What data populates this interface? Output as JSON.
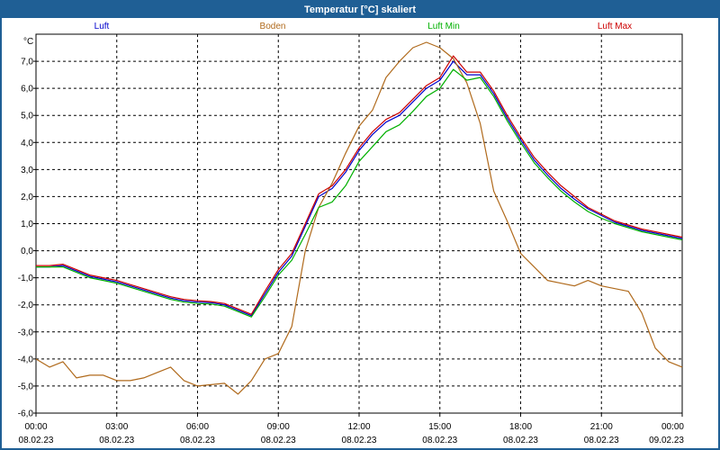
{
  "window": {
    "title": "Temperatur [°C] skaliert"
  },
  "chart_data": {
    "type": "line",
    "title": "Temperatur [°C] skaliert",
    "ylabel": "°C",
    "xlabel": "",
    "xlim": [
      0,
      24
    ],
    "ylim": [
      -6,
      8
    ],
    "grid": true,
    "legend_position": "top",
    "y_ticks": [
      "-6,0",
      "-5,0",
      "-4,0",
      "-3,0",
      "-2,0",
      "-1,0",
      "0,0",
      "1,0",
      "2,0",
      "3,0",
      "4,0",
      "5,0",
      "6,0",
      "7,0"
    ],
    "x_ticks": [
      {
        "time": "00:00",
        "date": "08.02.23"
      },
      {
        "time": "03:00",
        "date": "08.02.23"
      },
      {
        "time": "06:00",
        "date": "08.02.23"
      },
      {
        "time": "09:00",
        "date": "08.02.23"
      },
      {
        "time": "12:00",
        "date": "08.02.23"
      },
      {
        "time": "15:00",
        "date": "08.02.23"
      },
      {
        "time": "18:00",
        "date": "08.02.23"
      },
      {
        "time": "21:00",
        "date": "08.02.23"
      },
      {
        "time": "00:00",
        "date": "09.02.23"
      }
    ],
    "x_hours": [
      0,
      0.5,
      1,
      1.5,
      2,
      2.5,
      3,
      3.5,
      4,
      4.5,
      5,
      5.5,
      6,
      6.5,
      7,
      7.5,
      8,
      8.5,
      9,
      9.5,
      10,
      10.5,
      11,
      11.5,
      12,
      12.5,
      13,
      13.5,
      14,
      14.5,
      15,
      15.5,
      16,
      16.5,
      17,
      17.5,
      18,
      18.5,
      19,
      19.5,
      20,
      20.5,
      21,
      21.5,
      22,
      22.5,
      23,
      23.5,
      24
    ],
    "series": [
      {
        "name": "Luft",
        "color": "#0000cc",
        "values": [
          -0.6,
          -0.6,
          -0.55,
          -0.75,
          -0.95,
          -1.05,
          -1.15,
          -1.3,
          -1.45,
          -1.6,
          -1.75,
          -1.85,
          -1.9,
          -1.92,
          -2.0,
          -2.2,
          -2.4,
          -1.6,
          -0.8,
          -0.2,
          0.9,
          2.0,
          2.3,
          2.9,
          3.7,
          4.3,
          4.75,
          5.0,
          5.5,
          6.0,
          6.3,
          7.0,
          6.5,
          6.5,
          5.8,
          4.9,
          4.1,
          3.35,
          2.8,
          2.3,
          1.9,
          1.55,
          1.3,
          1.05,
          0.9,
          0.75,
          0.65,
          0.55,
          0.45
        ]
      },
      {
        "name": "Boden",
        "color": "#b06a1c",
        "values": [
          -4.0,
          -4.3,
          -4.1,
          -4.7,
          -4.6,
          -4.6,
          -4.8,
          -4.8,
          -4.7,
          -4.5,
          -4.3,
          -4.8,
          -5.0,
          -4.95,
          -4.9,
          -5.3,
          -4.8,
          -4.0,
          -3.8,
          -2.8,
          0.0,
          1.6,
          2.5,
          3.6,
          4.6,
          5.2,
          6.4,
          7.0,
          7.5,
          7.7,
          7.5,
          7.1,
          6.2,
          4.7,
          2.2,
          1.1,
          -0.1,
          -0.6,
          -1.1,
          -1.2,
          -1.3,
          -1.1,
          -1.3,
          -1.4,
          -1.5,
          -2.3,
          -3.6,
          -4.1,
          -4.3
        ]
      },
      {
        "name": "Luft Min",
        "color": "#00b000",
        "values": [
          -0.6,
          -0.6,
          -0.6,
          -0.8,
          -1.0,
          -1.1,
          -1.2,
          -1.35,
          -1.5,
          -1.65,
          -1.8,
          -1.9,
          -1.95,
          -1.97,
          -2.05,
          -2.25,
          -2.45,
          -1.7,
          -0.9,
          -0.35,
          0.6,
          1.6,
          1.8,
          2.4,
          3.3,
          3.85,
          4.4,
          4.65,
          5.15,
          5.7,
          6.0,
          6.7,
          6.3,
          6.4,
          5.7,
          4.8,
          4.0,
          3.25,
          2.7,
          2.2,
          1.8,
          1.45,
          1.2,
          1.0,
          0.85,
          0.7,
          0.6,
          0.5,
          0.4
        ]
      },
      {
        "name": "Luft Max",
        "color": "#cc0000",
        "values": [
          -0.55,
          -0.55,
          -0.5,
          -0.7,
          -0.9,
          -1.0,
          -1.1,
          -1.25,
          -1.4,
          -1.55,
          -1.7,
          -1.8,
          -1.85,
          -1.88,
          -1.95,
          -2.15,
          -2.35,
          -1.5,
          -0.7,
          -0.1,
          1.0,
          2.1,
          2.4,
          3.0,
          3.8,
          4.4,
          4.85,
          5.1,
          5.6,
          6.1,
          6.4,
          7.2,
          6.6,
          6.6,
          5.9,
          5.0,
          4.2,
          3.45,
          2.9,
          2.4,
          2.0,
          1.6,
          1.35,
          1.1,
          0.95,
          0.8,
          0.7,
          0.6,
          0.5
        ]
      }
    ]
  }
}
